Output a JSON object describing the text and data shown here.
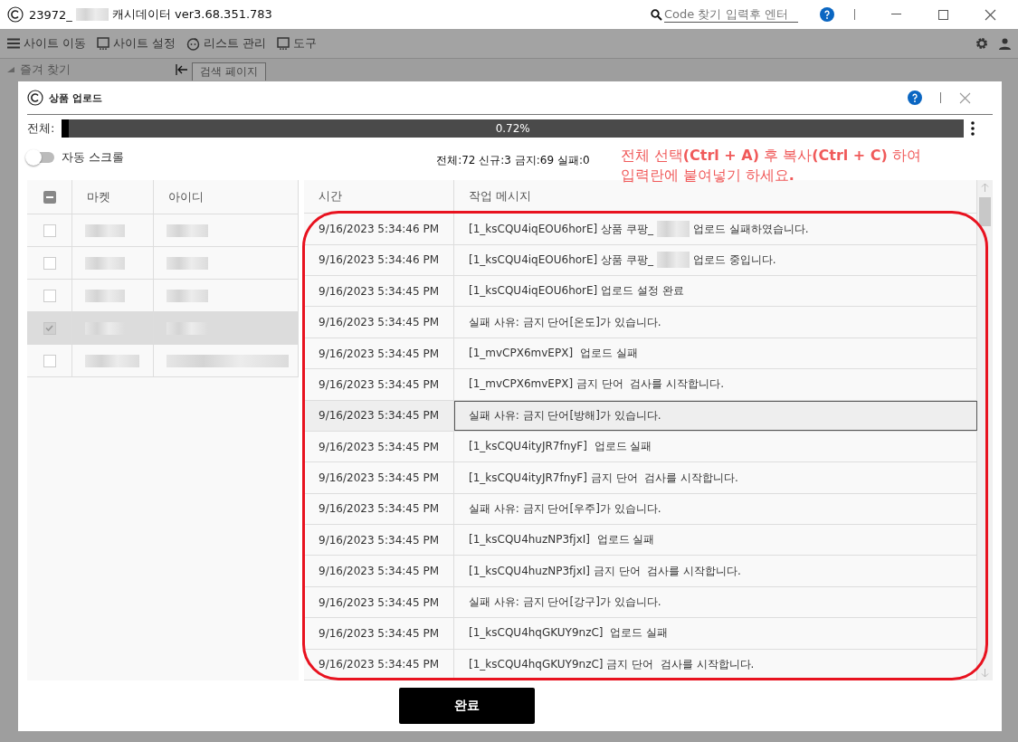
{
  "window": {
    "title_start": "23972_",
    "title_end": "캐시데이터 ver3.68.351.783",
    "search": {
      "placeholder": "Code 찾기 입력후 엔터"
    }
  },
  "toolbar": [
    {
      "kind": "menu",
      "label": "사이트 이동"
    },
    {
      "kind": "window",
      "label": "사이트 설정"
    },
    {
      "kind": "face",
      "label": "리스트 관리"
    },
    {
      "kind": "window",
      "label": "도구"
    }
  ],
  "sidebar": {
    "header": "즐겨 찾기"
  },
  "tab": "검색 페이지",
  "dialog": {
    "title": "상품 업로드",
    "progress": {
      "label": "전체:",
      "level": 0.0072,
      "reading": "0.72%"
    },
    "auto_scroll": {
      "label": "자동 스크롤",
      "on": false
    },
    "stats": "전체:72 신규:3 금지:69 실패:0",
    "annotation_lines": [
      "전체 선택**(Ctrl + A)** 후 복사**(Ctrl + C)** 하여",
      "입력란에 붙여넣기 하세요**.**"
    ],
    "accounts": {
      "select_all_partial": true,
      "columns": [
        "마켓",
        "아이디"
      ],
      "rows": [
        {
          "checked": false,
          "selected": false
        },
        {
          "checked": false,
          "selected": false
        },
        {
          "checked": false,
          "selected": false
        },
        {
          "checked": true,
          "selected": true
        },
        {
          "checked": false,
          "selected": false
        }
      ]
    },
    "log": {
      "columns": [
        "시간",
        "작업 메시지"
      ],
      "rows": [
        {
          "time": "9/16/2023 5:34:46 PM",
          "message": "[1_ksCQU4iqEOU6horE] 상품 쿠팡_",
          "message_end": "업로드 실패하였습니다.",
          "selected": false
        },
        {
          "time": "9/16/2023 5:34:46 PM",
          "message": "[1_ksCQU4iqEOU6horE] 상품 쿠팡_",
          "message_end": "업로드 중입니다.",
          "selected": false
        },
        {
          "time": "9/16/2023 5:34:45 PM",
          "message": "[1_ksCQU4iqEOU6horE] 업로드 설정 완료",
          "selected": false
        },
        {
          "time": "9/16/2023 5:34:45 PM",
          "message": "실패 사유: 금지 단어[온도]가 있습니다.",
          "selected": false
        },
        {
          "time": "9/16/2023 5:34:45 PM",
          "message": "[1_mvCPX6mvEPX]  업로드 실패",
          "selected": false
        },
        {
          "time": "9/16/2023 5:34:45 PM",
          "message": "[1_mvCPX6mvEPX] 금지 단어  검사를 시작합니다.",
          "selected": false
        },
        {
          "time": "9/16/2023 5:34:45 PM",
          "message": "실패 사유: 금지 단어[방해]가 있습니다.",
          "selected": true
        },
        {
          "time": "9/16/2023 5:34:45 PM",
          "message": "[1_ksCQU4ityJR7fnyF]  업로드 실패",
          "selected": false
        },
        {
          "time": "9/16/2023 5:34:45 PM",
          "message": "[1_ksCQU4ityJR7fnyF] 금지 단어  검사를 시작합니다.",
          "selected": false
        },
        {
          "time": "9/16/2023 5:34:45 PM",
          "message": "실패 사유: 금지 단어[우주]가 있습니다.",
          "selected": false
        },
        {
          "time": "9/16/2023 5:34:45 PM",
          "message": "[1_ksCQU4huzNP3fjxI]  업로드 실패",
          "selected": false
        },
        {
          "time": "9/16/2023 5:34:45 PM",
          "message": "[1_ksCQU4huzNP3fjxI] 금지 단어  검사를 시작합니다.",
          "selected": false
        },
        {
          "time": "9/16/2023 5:34:45 PM",
          "message": "실패 사유: 금지 단어[강구]가 있습니다.",
          "selected": false
        },
        {
          "time": "9/16/2023 5:34:45 PM",
          "message": "[1_ksCQU4hqGKUY9nzC]  업로드 실패",
          "selected": false
        },
        {
          "time": "9/16/2023 5:34:45 PM",
          "message": "[1_ksCQU4hqGKUY9nzC] 금지 단어  검사를 시작합니다.",
          "selected": false
        }
      ]
    },
    "done_button": "완료"
  }
}
